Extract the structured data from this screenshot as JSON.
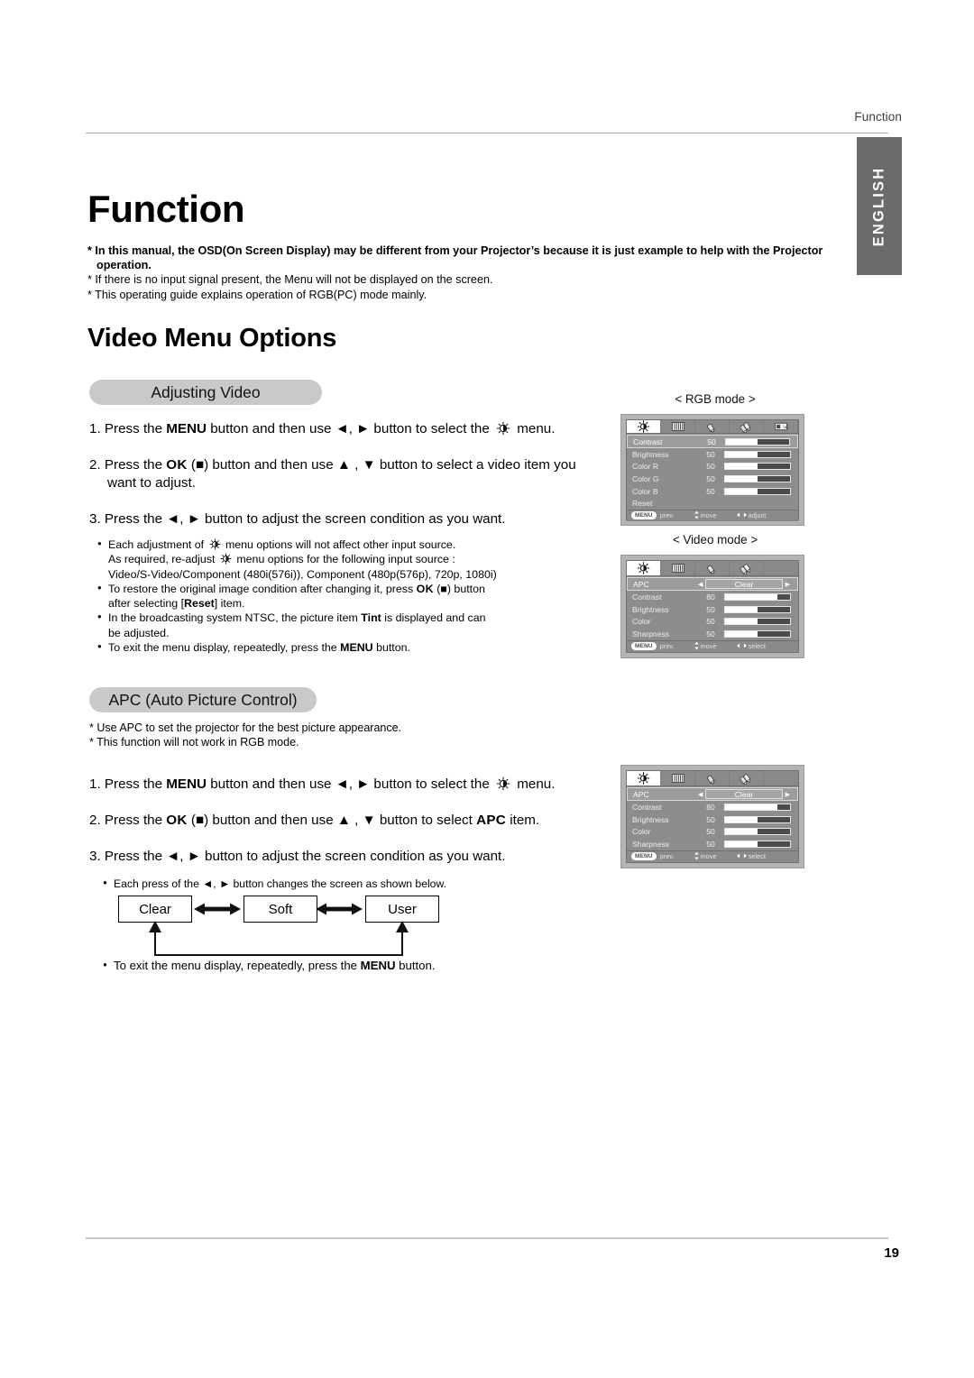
{
  "header": {
    "running_head": "Function"
  },
  "side_tab": {
    "label": "ENGLISH"
  },
  "page": {
    "title": "Function",
    "section_title": "Video Menu Options",
    "number": "19"
  },
  "notes": {
    "note1": "* In this manual, the OSD(On Screen Display) may be different from your Projector’s because it is just example to help with the Projector",
    "note1_cont": "operation.",
    "note2": "* If there is no input signal present, the Menu will not be displayed on the screen.",
    "note3": "* This operating guide explains operation of RGB(PC) mode mainly."
  },
  "adjusting_video": {
    "pill_label": "Adjusting Video",
    "steps": [
      {
        "num": "1.",
        "pre": "Press the ",
        "bold1": "MENU",
        "mid": " button and then use ◄, ► button to select the ",
        "post": "menu."
      },
      {
        "num": "2.",
        "pre": "Press the ",
        "bold1": "OK",
        "mid": " (■) button and then use ▲ , ▼ button to select a video item you",
        "line2": "want to adjust."
      },
      {
        "num": "3.",
        "text": "Press the ◄, ► button to adjust the screen condition as you want."
      }
    ],
    "bullets": {
      "b1_a": "Each adjustment of ",
      "b1_b": " menu options will not affect other input source.",
      "b1_line2_a": "As required, re-adjust ",
      "b1_line2_b": " menu options for the following input source :",
      "b1_line3": "Video/S-Video/Component (480i(576i)), Component (480p(576p), 720p, 1080i)",
      "b2_a": "To restore the original image condition after changing it, press ",
      "b2_ok": "OK",
      "b2_b": " (■) button",
      "b2_line2_a": "after selecting [",
      "b2_line2_reset": "Reset",
      "b2_line2_b": "] item.",
      "b3_a": "In the broadcasting system NTSC, the picture item ",
      "b3_tint": "Tint",
      "b3_b": " is displayed and can",
      "b3_line2": "be adjusted.",
      "b4_a": "To exit the menu display, repeatedly, press the ",
      "b4_menu": "MENU",
      "b4_b": " button."
    }
  },
  "apc": {
    "pill_label": "APC (Auto Picture Control)",
    "note1": "* Use APC to set the projector for the best picture appearance.",
    "note2": "* This function will not work in RGB mode.",
    "steps": [
      {
        "num": "1.",
        "pre": "Press the ",
        "bold1": "MENU",
        "mid": " button and then use ◄, ► button to select the ",
        "post": "menu."
      },
      {
        "num": "2.",
        "pre": "Press the ",
        "bold1": "OK",
        "mid": " (■) button and then use ▲ , ▼ button to select ",
        "bold2": "APC",
        "post": " item."
      },
      {
        "num": "3.",
        "text": "Press the ◄, ► button to adjust the screen condition as you want."
      }
    ],
    "bullet_each_press_a": "Each press of the ◄, ► button changes the screen as shown below.",
    "bullet_exit_a": "To exit the menu display, repeatedly, press the ",
    "bullet_exit_menu": "MENU",
    "bullet_exit_b": " button.",
    "flow": {
      "box1": "Clear",
      "box2": "Soft",
      "box3": "User"
    }
  },
  "osd_rgb": {
    "caption": "< RGB mode >",
    "tabs": [
      {
        "icon": "brightness-sun-icon",
        "active": true
      },
      {
        "icon": "screen-grid-icon",
        "active": false
      },
      {
        "icon": "pencil-icon",
        "active": false
      },
      {
        "icon": "double-pencil-icon",
        "active": false
      },
      {
        "icon": "display-card-icon",
        "active": false
      }
    ],
    "rows": [
      {
        "label": "Contrast",
        "value": "50",
        "fill": 50,
        "selected": true
      },
      {
        "label": "Brightness",
        "value": "50",
        "fill": 50,
        "selected": false
      },
      {
        "label": "Color R",
        "value": "50",
        "fill": 50,
        "selected": false
      },
      {
        "label": "Color G",
        "value": "50",
        "fill": 50,
        "selected": false
      },
      {
        "label": "Color B",
        "value": "50",
        "fill": 50,
        "selected": false
      },
      {
        "label": "Reset",
        "value": "",
        "fill": null,
        "selected": false
      }
    ],
    "footer": {
      "menu_chip": "MENU",
      "prev": "prev.",
      "move": "move",
      "action": "adjust"
    }
  },
  "osd_video": {
    "caption": "< Video mode >",
    "tabs": [
      {
        "icon": "brightness-sun-icon",
        "active": true
      },
      {
        "icon": "screen-grid-icon",
        "active": false
      },
      {
        "icon": "pencil-icon",
        "active": false
      },
      {
        "icon": "double-pencil-icon",
        "active": false
      }
    ],
    "rows": [
      {
        "label": "APC",
        "value": "Clear",
        "type": "selector",
        "selected": true
      },
      {
        "label": "Contrast",
        "value": "80",
        "fill": 80,
        "selected": false
      },
      {
        "label": "Brightness",
        "value": "50",
        "fill": 50,
        "selected": false
      },
      {
        "label": "Color",
        "value": "50",
        "fill": 50,
        "selected": false
      },
      {
        "label": "Sharpness",
        "value": "50",
        "fill": 50,
        "selected": false
      }
    ],
    "footer": {
      "menu_chip": "MENU",
      "prev": "prev.",
      "move": "move",
      "action": "select"
    }
  },
  "osd_apc": {
    "caption": "",
    "tabs": [
      {
        "icon": "brightness-sun-icon",
        "active": true
      },
      {
        "icon": "screen-grid-icon",
        "active": false
      },
      {
        "icon": "pencil-icon",
        "active": false
      },
      {
        "icon": "double-pencil-icon",
        "active": false
      }
    ],
    "rows": [
      {
        "label": "APC",
        "value": "Clear",
        "type": "selector",
        "selected": true
      },
      {
        "label": "Contrast",
        "value": "80",
        "fill": 80,
        "selected": false
      },
      {
        "label": "Brightness",
        "value": "50",
        "fill": 50,
        "selected": false
      },
      {
        "label": "Color",
        "value": "50",
        "fill": 50,
        "selected": false
      },
      {
        "label": "Sharpness",
        "value": "50",
        "fill": 50,
        "selected": false
      }
    ],
    "footer": {
      "menu_chip": "MENU",
      "prev": "prev.",
      "move": "move",
      "action": "select"
    }
  },
  "colors": {
    "side_tab_bg": "#6b6b6b",
    "pill_bg": "#c9c9c9",
    "osd_frame": "#b4b4b4",
    "osd_body": "#8d8d8d",
    "rule": "#a8a8a8"
  }
}
